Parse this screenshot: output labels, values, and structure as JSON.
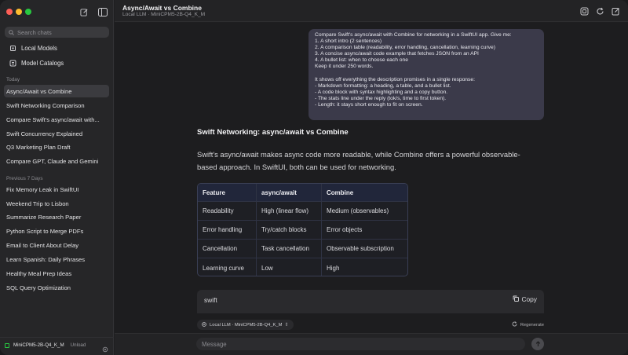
{
  "sidebar": {
    "search_placeholder": "Search chats",
    "nav": [
      {
        "label": "Local Models",
        "icon": "chip-icon"
      },
      {
        "label": "Model Catalogs",
        "icon": "catalog-icon"
      }
    ],
    "sections": [
      {
        "label": "Today",
        "items": [
          "Async/Await vs Combine",
          "Swift Networking Comparison",
          "Compare Swift's async/await with...",
          "Swift Concurrency Explained",
          "Q3 Marketing Plan Draft",
          "Compare GPT, Claude and Gemini"
        ]
      },
      {
        "label": "Previous 7 Days",
        "items": [
          "Fix Memory Leak in SwiftUI",
          "Weekend Trip to Lisbon",
          "Summarize Research Paper",
          "Python Script to Merge PDFs",
          "Email to Client About Delay",
          "Learn Spanish: Daily Phrases",
          "Healthy Meal Prep Ideas",
          "SQL Query Optimization"
        ]
      }
    ],
    "active_chat_index": 0,
    "model_bar": {
      "model": "MiniCPM5-2B-Q4_K_M",
      "unload": "Unload"
    }
  },
  "header": {
    "title": "Async/Await vs Combine",
    "subtitle": "Local LLM · MiniCPM5-2B-Q4_K_M"
  },
  "user_message": {
    "lines": [
      "Compare Swift's async/await with Combine for networking in a SwiftUI app. Give me:",
      "1. A short intro (2 sentences)",
      "2. A comparison table (readability, error handling, cancellation, learning curve)",
      "3. A concise async/await code example that fetches JSON from an API",
      "4. A bullet list: when to choose each one",
      "Keep it under 250 words.",
      "",
      "It shows off everything the description promises in a single response:",
      "- Markdown formatting: a heading, a table, and a bullet list.",
      "- A code block with syntax highlighting and a copy button.",
      "- The stats line under the reply (tok/s, time to first token).",
      "- Length: it stays short enough to fit on screen."
    ]
  },
  "response": {
    "heading": "Swift Networking: async/await vs Combine",
    "intro": "Swift's async/await makes async code more readable, while Combine offers a powerful observable-based approach. In SwiftUI, both can be used for networking.",
    "table": {
      "headers": [
        "Feature",
        "async/await",
        "Combine"
      ],
      "rows": [
        [
          "Readability",
          "High (linear flow)",
          "Medium (observables)"
        ],
        [
          "Error handling",
          "Try/catch blocks",
          "Error objects"
        ],
        [
          "Cancellation",
          "Task cancellation",
          "Observable subscription"
        ],
        [
          "Learning curve",
          "Low",
          "High"
        ]
      ]
    },
    "code_block": {
      "language": "swift",
      "copy_label": "Copy"
    },
    "meta": {
      "model": "Local LLM · MiniCPM5-2B-Q4_K_M",
      "regenerate": "Regenerate"
    }
  },
  "composer": {
    "placeholder": "Message"
  },
  "colors": {
    "user_bubble": "#3b3a4a",
    "table_border": "#3a3f55",
    "traffic_red": "#fe5f57",
    "traffic_yellow": "#febc2e",
    "traffic_green": "#28c840"
  }
}
